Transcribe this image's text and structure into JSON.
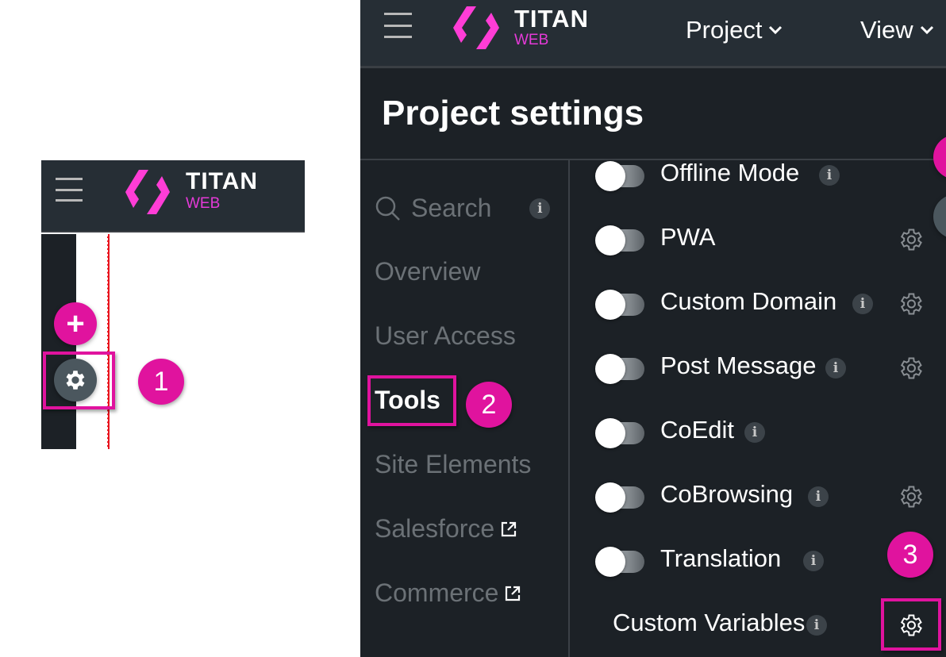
{
  "mini_panel": {
    "logo": {
      "main": "TITAN",
      "sub": "WEB"
    },
    "add_button_glyph": "+",
    "gear_icon": "gear-icon",
    "step_badge": "1"
  },
  "main_panel": {
    "logo": {
      "main": "TITAN",
      "sub": "WEB"
    },
    "menus": [
      {
        "label": "Project",
        "icon": "chevron-down-icon"
      },
      {
        "label": "View",
        "icon": "chevron-down-icon"
      }
    ],
    "page_title": "Project settings",
    "search": {
      "label": "Search",
      "icon": "search-icon",
      "info": "i"
    },
    "nav_items": [
      {
        "label": "Overview",
        "active": false
      },
      {
        "label": "User Access",
        "active": false
      },
      {
        "label": "Tools",
        "active": true
      },
      {
        "label": "Site Elements",
        "active": false
      },
      {
        "label": "Salesforce",
        "active": false,
        "external": true
      },
      {
        "label": "Commerce",
        "active": false,
        "external": true
      }
    ],
    "step_badge_2": "2",
    "step_badge_3": "3",
    "settings": [
      {
        "label": "Offline Mode",
        "toggle": true,
        "on": false,
        "info": true,
        "gear": false
      },
      {
        "label": "PWA",
        "toggle": true,
        "on": false,
        "info": false,
        "gear": true
      },
      {
        "label": "Custom Domain",
        "toggle": true,
        "on": false,
        "info": true,
        "gear": true
      },
      {
        "label": "Post Message",
        "toggle": true,
        "on": false,
        "info": true,
        "gear": true
      },
      {
        "label": "CoEdit",
        "toggle": true,
        "on": false,
        "info": true,
        "gear": false
      },
      {
        "label": "CoBrowsing",
        "toggle": true,
        "on": false,
        "info": true,
        "gear": true
      },
      {
        "label": "Translation",
        "toggle": true,
        "on": false,
        "info": true,
        "gear": false
      },
      {
        "label": "Custom Variables",
        "toggle": false,
        "info": true,
        "gear": true
      }
    ],
    "info_glyph": "i"
  },
  "colors": {
    "accent": "#e0139e",
    "logo_pink": "#e53ad8",
    "header_bg": "#262e35",
    "panel_bg": "#1c2126",
    "muted_text": "#6b7176"
  }
}
